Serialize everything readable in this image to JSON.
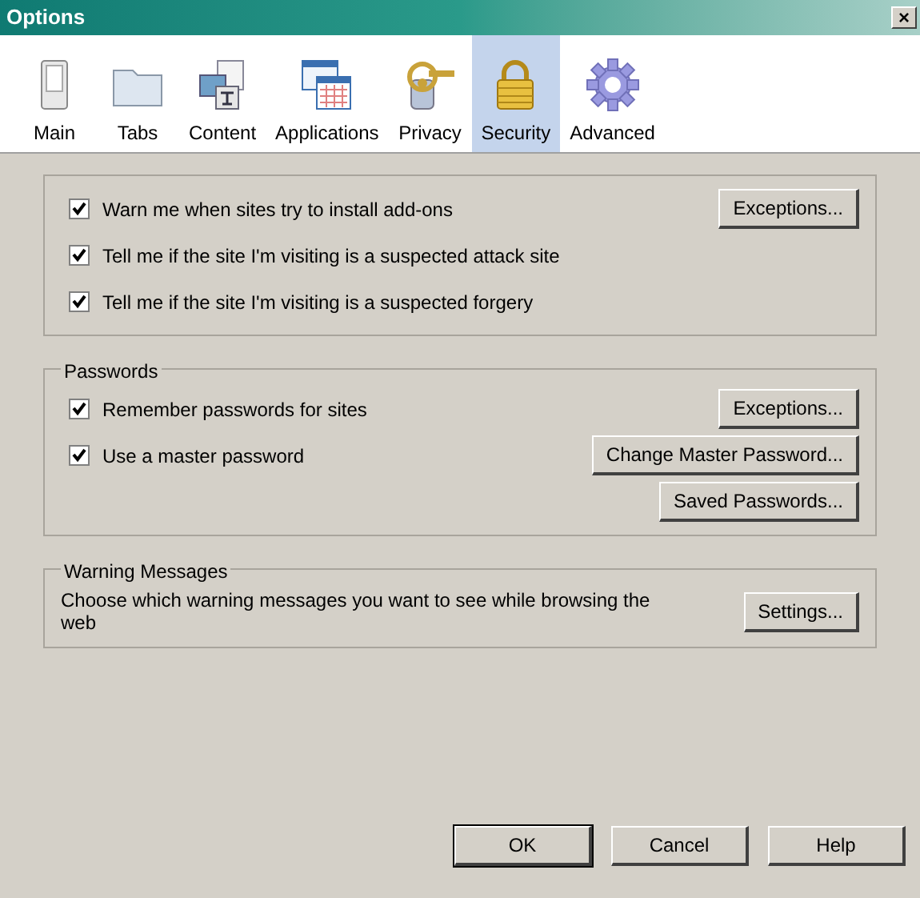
{
  "window": {
    "title": "Options",
    "close": "×"
  },
  "tabs": [
    {
      "label": "Main",
      "kind": "switch",
      "selected": false
    },
    {
      "label": "Tabs",
      "kind": "folder",
      "selected": false
    },
    {
      "label": "Content",
      "kind": "content",
      "selected": false
    },
    {
      "label": "Applications",
      "kind": "apps",
      "selected": false
    },
    {
      "label": "Privacy",
      "kind": "key",
      "selected": false
    },
    {
      "label": "Security",
      "kind": "lock",
      "selected": true
    },
    {
      "label": "Advanced",
      "kind": "gear",
      "selected": false
    }
  ],
  "groups": [
    {
      "rows": [
        {
          "kind": "check",
          "label": "Warn me when sites try to install add-ons",
          "checked": true,
          "button": "Exceptions..."
        },
        {
          "kind": "check",
          "label": "Tell me if the site I'm visiting is a suspected attack site",
          "checked": true
        },
        {
          "kind": "check",
          "label": "Tell me if the site I'm visiting is a suspected forgery",
          "checked": true
        }
      ]
    },
    {
      "title": "Passwords",
      "rows": [
        {
          "kind": "check",
          "label": "Remember passwords for sites",
          "checked": true,
          "button": "Exceptions..."
        },
        {
          "kind": "check",
          "label": "Use a master password",
          "checked": true,
          "button": "Change Master Password..."
        },
        {
          "kind": "button",
          "button": "Saved Passwords..."
        }
      ]
    },
    {
      "title": "Warning Messages",
      "rows": [
        {
          "kind": "text",
          "label": "Choose which warning messages you want to see while browsing the web",
          "button": "Settings..."
        }
      ]
    }
  ],
  "buttons": [
    {
      "label": "OK",
      "default": true
    },
    {
      "label": "Cancel",
      "default": false
    },
    {
      "label": "Help",
      "default": false
    }
  ]
}
